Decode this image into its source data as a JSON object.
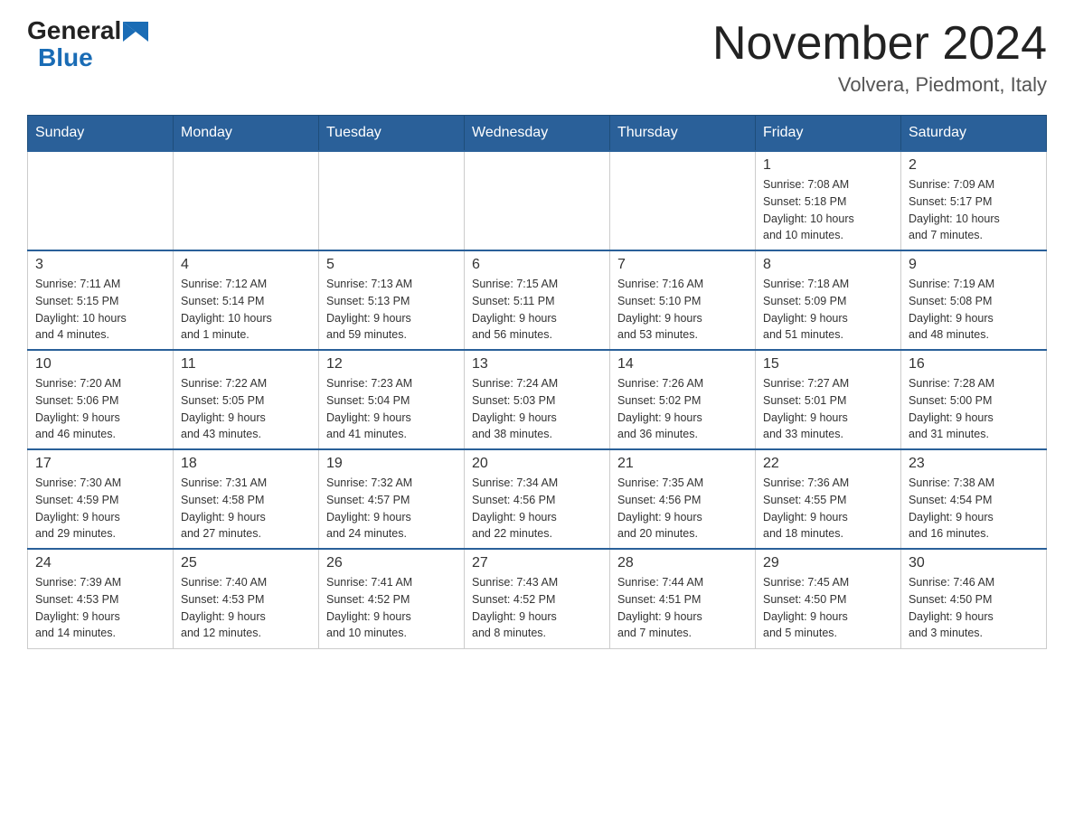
{
  "header": {
    "logo_general": "General",
    "logo_blue": "Blue",
    "title": "November 2024",
    "subtitle": "Volvera, Piedmont, Italy"
  },
  "weekdays": [
    "Sunday",
    "Monday",
    "Tuesday",
    "Wednesday",
    "Thursday",
    "Friday",
    "Saturday"
  ],
  "weeks": [
    [
      {
        "day": "",
        "info": ""
      },
      {
        "day": "",
        "info": ""
      },
      {
        "day": "",
        "info": ""
      },
      {
        "day": "",
        "info": ""
      },
      {
        "day": "",
        "info": ""
      },
      {
        "day": "1",
        "info": "Sunrise: 7:08 AM\nSunset: 5:18 PM\nDaylight: 10 hours\nand 10 minutes."
      },
      {
        "day": "2",
        "info": "Sunrise: 7:09 AM\nSunset: 5:17 PM\nDaylight: 10 hours\nand 7 minutes."
      }
    ],
    [
      {
        "day": "3",
        "info": "Sunrise: 7:11 AM\nSunset: 5:15 PM\nDaylight: 10 hours\nand 4 minutes."
      },
      {
        "day": "4",
        "info": "Sunrise: 7:12 AM\nSunset: 5:14 PM\nDaylight: 10 hours\nand 1 minute."
      },
      {
        "day": "5",
        "info": "Sunrise: 7:13 AM\nSunset: 5:13 PM\nDaylight: 9 hours\nand 59 minutes."
      },
      {
        "day": "6",
        "info": "Sunrise: 7:15 AM\nSunset: 5:11 PM\nDaylight: 9 hours\nand 56 minutes."
      },
      {
        "day": "7",
        "info": "Sunrise: 7:16 AM\nSunset: 5:10 PM\nDaylight: 9 hours\nand 53 minutes."
      },
      {
        "day": "8",
        "info": "Sunrise: 7:18 AM\nSunset: 5:09 PM\nDaylight: 9 hours\nand 51 minutes."
      },
      {
        "day": "9",
        "info": "Sunrise: 7:19 AM\nSunset: 5:08 PM\nDaylight: 9 hours\nand 48 minutes."
      }
    ],
    [
      {
        "day": "10",
        "info": "Sunrise: 7:20 AM\nSunset: 5:06 PM\nDaylight: 9 hours\nand 46 minutes."
      },
      {
        "day": "11",
        "info": "Sunrise: 7:22 AM\nSunset: 5:05 PM\nDaylight: 9 hours\nand 43 minutes."
      },
      {
        "day": "12",
        "info": "Sunrise: 7:23 AM\nSunset: 5:04 PM\nDaylight: 9 hours\nand 41 minutes."
      },
      {
        "day": "13",
        "info": "Sunrise: 7:24 AM\nSunset: 5:03 PM\nDaylight: 9 hours\nand 38 minutes."
      },
      {
        "day": "14",
        "info": "Sunrise: 7:26 AM\nSunset: 5:02 PM\nDaylight: 9 hours\nand 36 minutes."
      },
      {
        "day": "15",
        "info": "Sunrise: 7:27 AM\nSunset: 5:01 PM\nDaylight: 9 hours\nand 33 minutes."
      },
      {
        "day": "16",
        "info": "Sunrise: 7:28 AM\nSunset: 5:00 PM\nDaylight: 9 hours\nand 31 minutes."
      }
    ],
    [
      {
        "day": "17",
        "info": "Sunrise: 7:30 AM\nSunset: 4:59 PM\nDaylight: 9 hours\nand 29 minutes."
      },
      {
        "day": "18",
        "info": "Sunrise: 7:31 AM\nSunset: 4:58 PM\nDaylight: 9 hours\nand 27 minutes."
      },
      {
        "day": "19",
        "info": "Sunrise: 7:32 AM\nSunset: 4:57 PM\nDaylight: 9 hours\nand 24 minutes."
      },
      {
        "day": "20",
        "info": "Sunrise: 7:34 AM\nSunset: 4:56 PM\nDaylight: 9 hours\nand 22 minutes."
      },
      {
        "day": "21",
        "info": "Sunrise: 7:35 AM\nSunset: 4:56 PM\nDaylight: 9 hours\nand 20 minutes."
      },
      {
        "day": "22",
        "info": "Sunrise: 7:36 AM\nSunset: 4:55 PM\nDaylight: 9 hours\nand 18 minutes."
      },
      {
        "day": "23",
        "info": "Sunrise: 7:38 AM\nSunset: 4:54 PM\nDaylight: 9 hours\nand 16 minutes."
      }
    ],
    [
      {
        "day": "24",
        "info": "Sunrise: 7:39 AM\nSunset: 4:53 PM\nDaylight: 9 hours\nand 14 minutes."
      },
      {
        "day": "25",
        "info": "Sunrise: 7:40 AM\nSunset: 4:53 PM\nDaylight: 9 hours\nand 12 minutes."
      },
      {
        "day": "26",
        "info": "Sunrise: 7:41 AM\nSunset: 4:52 PM\nDaylight: 9 hours\nand 10 minutes."
      },
      {
        "day": "27",
        "info": "Sunrise: 7:43 AM\nSunset: 4:52 PM\nDaylight: 9 hours\nand 8 minutes."
      },
      {
        "day": "28",
        "info": "Sunrise: 7:44 AM\nSunset: 4:51 PM\nDaylight: 9 hours\nand 7 minutes."
      },
      {
        "day": "29",
        "info": "Sunrise: 7:45 AM\nSunset: 4:50 PM\nDaylight: 9 hours\nand 5 minutes."
      },
      {
        "day": "30",
        "info": "Sunrise: 7:46 AM\nSunset: 4:50 PM\nDaylight: 9 hours\nand 3 minutes."
      }
    ]
  ]
}
